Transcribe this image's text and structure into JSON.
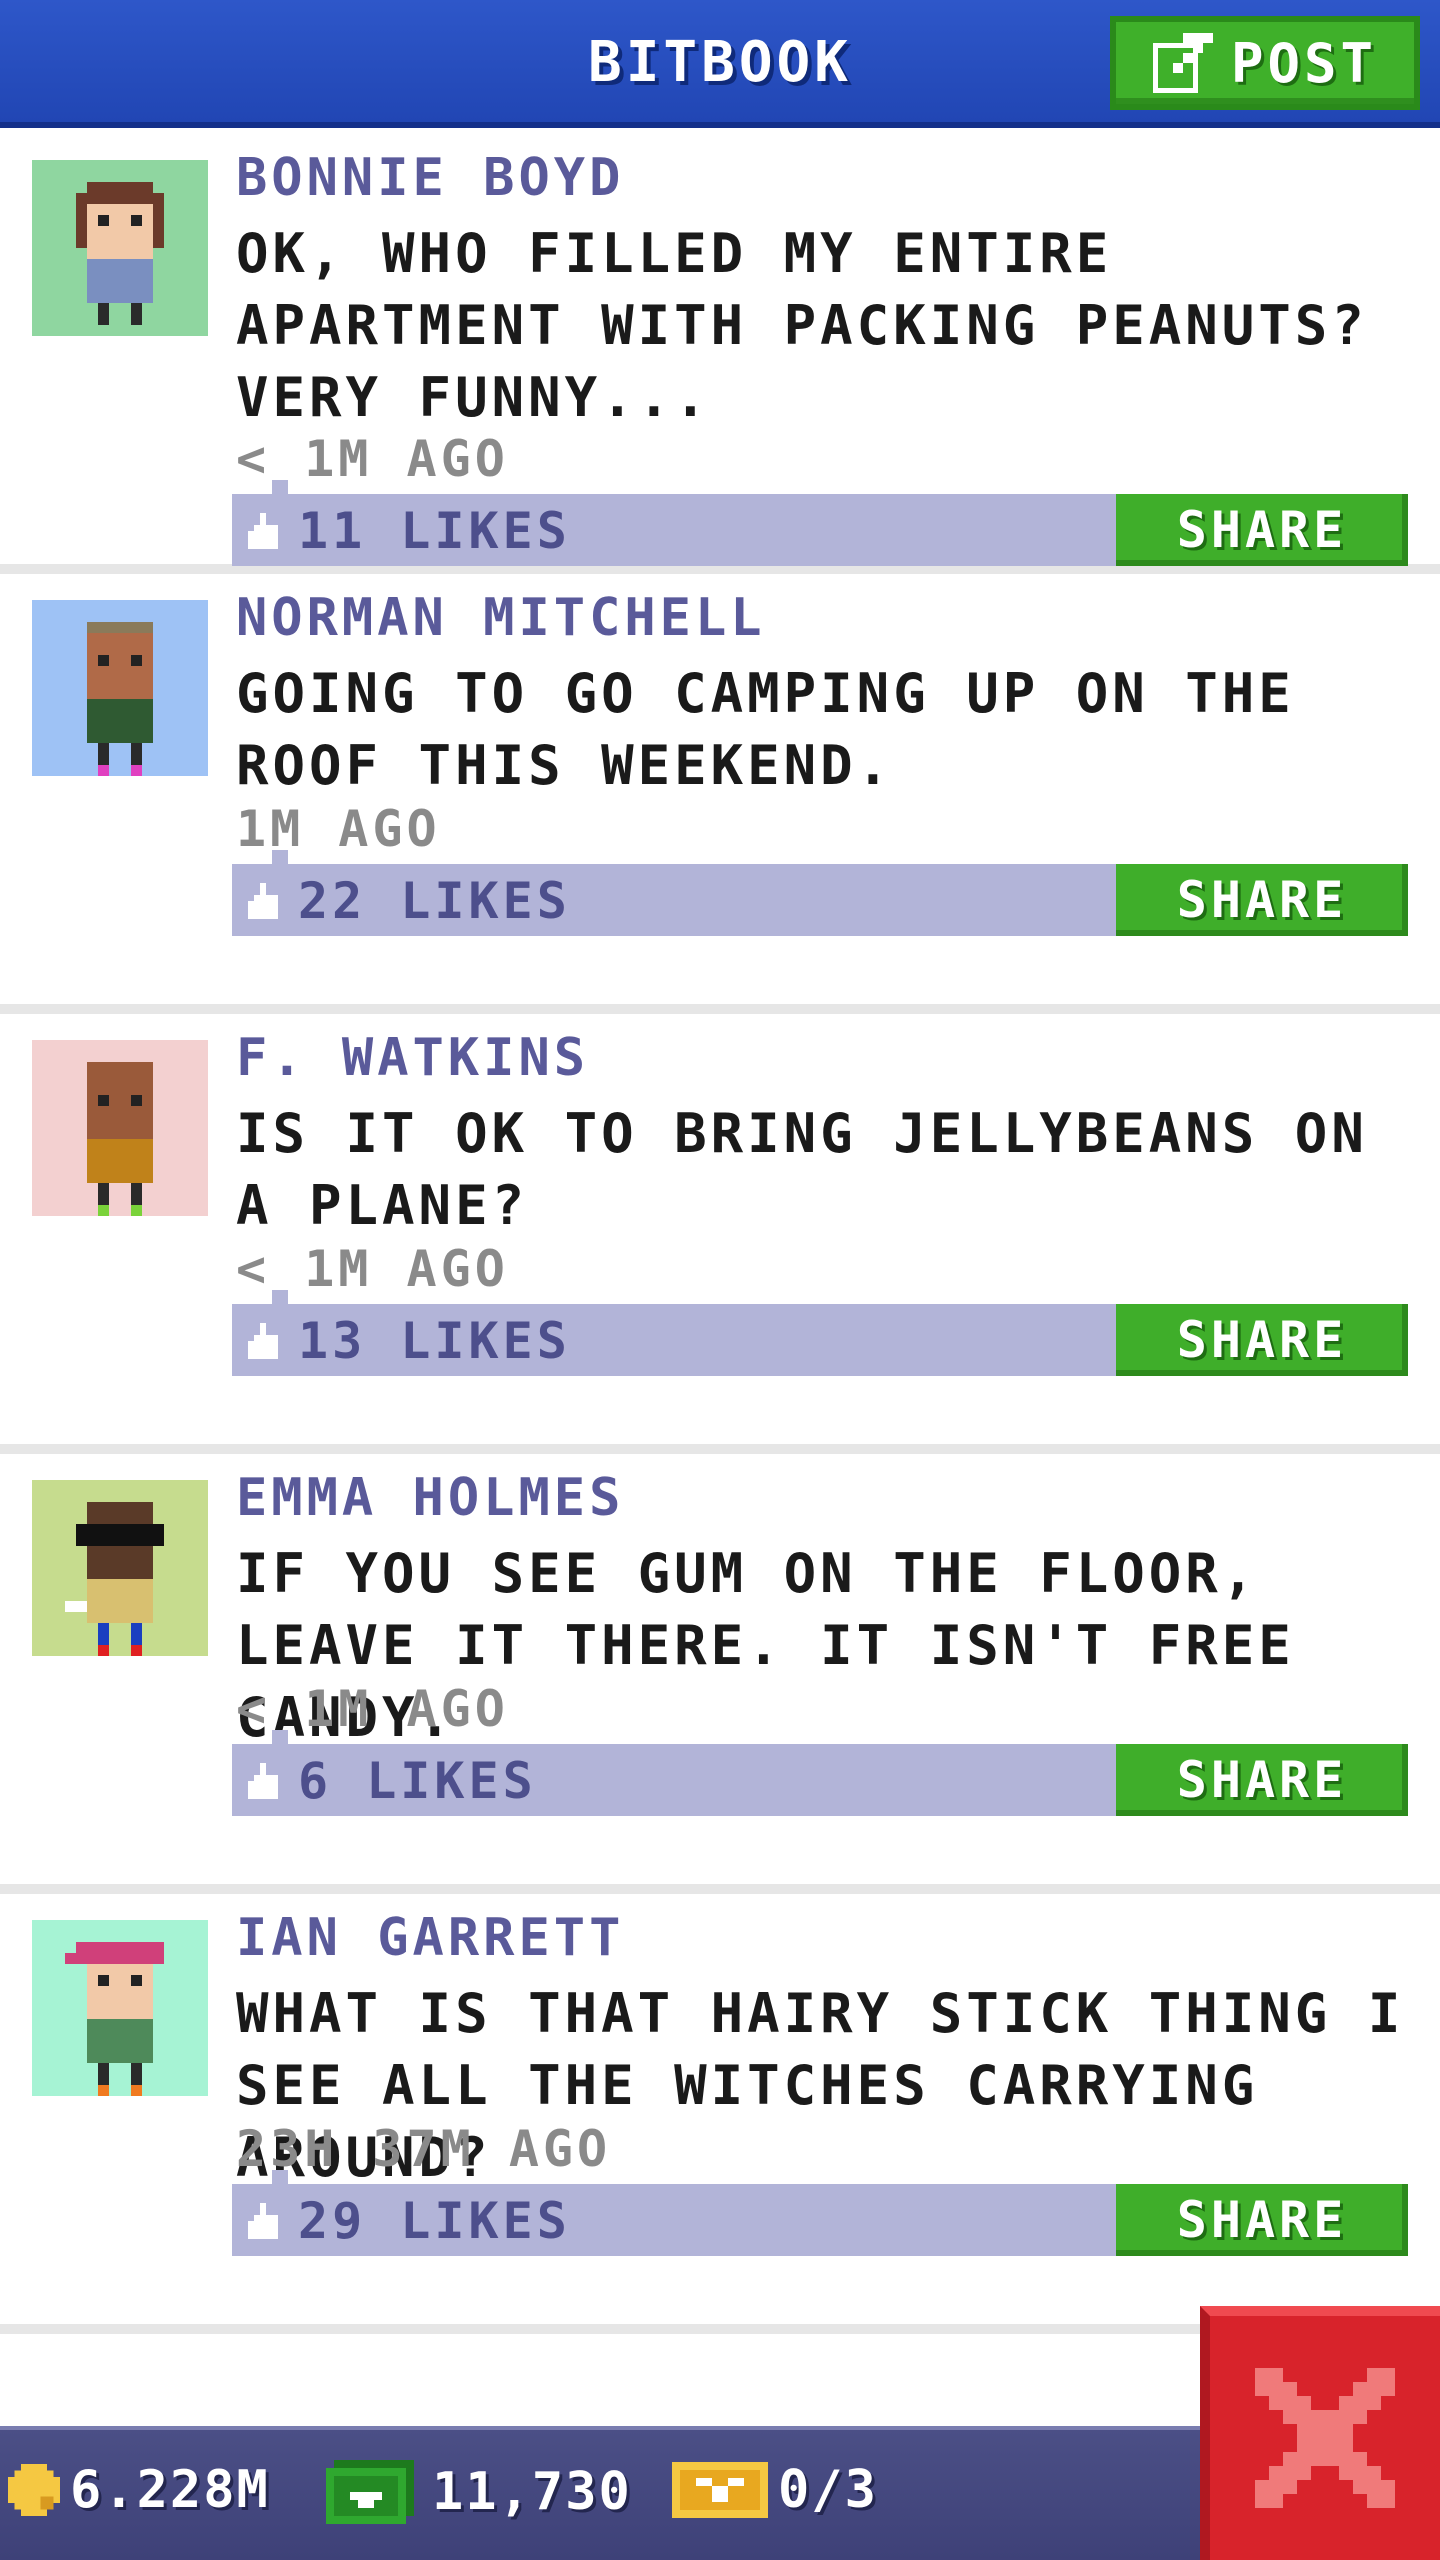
{
  "header": {
    "title": "BITBOOK",
    "post_label": "POST"
  },
  "posts": [
    {
      "author": "BONNIE BOYD",
      "text": "OK, WHO FILLED MY ENTIRE APARTMENT WITH PACKING PEANUTS? VERY FUNNY...",
      "time": "< 1M AGO",
      "likes": "11 LIKES",
      "share_label": "SHARE",
      "avatar_bg": "#8fd6a0"
    },
    {
      "author": "NORMAN MITCHELL",
      "text": "GOING TO GO CAMPING UP ON THE ROOF THIS WEEKEND.",
      "time": "1M AGO",
      "likes": "22 LIKES",
      "share_label": "SHARE",
      "avatar_bg": "#9ec2f5"
    },
    {
      "author": "F. WATKINS",
      "text": "IS IT OK TO BRING JELLYBEANS ON A PLANE?",
      "time": "< 1M AGO",
      "likes": "13 LIKES",
      "share_label": "SHARE",
      "avatar_bg": "#f3d0d0"
    },
    {
      "author": "EMMA HOLMES",
      "text": "IF YOU SEE GUM ON THE FLOOR, LEAVE IT THERE. IT ISN'T FREE CANDY.",
      "time": "< 1M AGO",
      "likes": "6 LIKES",
      "share_label": "SHARE",
      "avatar_bg": "#c6dc8e"
    },
    {
      "author": "IAN GARRETT",
      "text": "WHAT IS THAT HAIRY STICK THING I SEE ALL THE WITCHES CARRYING AROUND?",
      "time": "23H 37M AGO",
      "likes": "29 LIKES",
      "share_label": "SHARE",
      "avatar_bg": "#a6f3d4"
    }
  ],
  "footer": {
    "coins": "6.228M",
    "bux": "11,730",
    "tickets": "0/3"
  },
  "icons": {
    "post": "edit-icon",
    "like": "thumb-up-icon",
    "coin": "coin-icon",
    "bux": "bux-icon",
    "ticket": "ticket-icon",
    "close": "close-icon"
  },
  "colors": {
    "header_blue": "#2146b4",
    "post_green": "#3fb02a",
    "likes_bar": "#b2b4d8",
    "author_purple": "#5a5a9a",
    "footer": "#3e4178",
    "close_red": "#d8232b"
  }
}
